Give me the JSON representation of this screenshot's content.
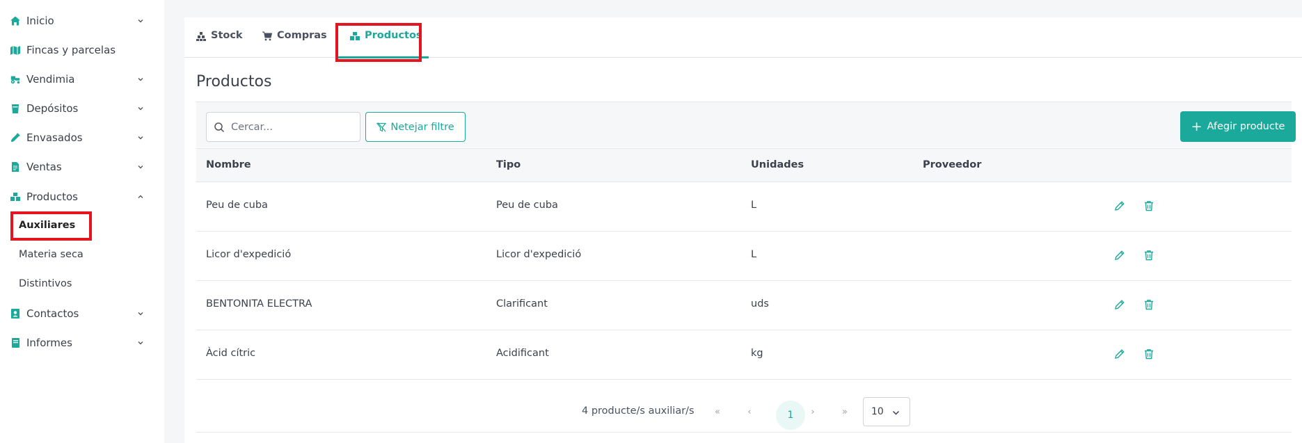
{
  "sidebar": {
    "items": [
      {
        "label": "Inicio",
        "icon": "home-icon"
      },
      {
        "label": "Fincas y parcelas",
        "icon": "map-icon"
      },
      {
        "label": "Vendimia",
        "icon": "tractor-icon"
      },
      {
        "label": "Depósitos",
        "icon": "tank-icon"
      },
      {
        "label": "Envasados",
        "icon": "bottle-icon"
      },
      {
        "label": "Ventas",
        "icon": "document-icon"
      },
      {
        "label": "Productos",
        "icon": "boxes-icon"
      },
      {
        "label": "Contactos",
        "icon": "contact-icon"
      },
      {
        "label": "Informes",
        "icon": "book-icon"
      }
    ],
    "subitems": [
      {
        "label": "Auxiliares"
      },
      {
        "label": "Materia seca"
      },
      {
        "label": "Distintivos"
      }
    ]
  },
  "tabs": [
    {
      "label": "Stock",
      "icon": "stock-icon"
    },
    {
      "label": "Compras",
      "icon": "cart-icon"
    },
    {
      "label": "Productos",
      "icon": "boxes-icon"
    }
  ],
  "page": {
    "title": "Productos"
  },
  "toolbar": {
    "search_placeholder": "Cercar...",
    "filter_label": "Netejar filtre",
    "add_label": "Afegir producte"
  },
  "table": {
    "headers": [
      "Nombre",
      "Tipo",
      "Unidades",
      "Proveedor"
    ],
    "rows": [
      {
        "nombre": "Peu de cuba",
        "tipo": "Peu de cuba",
        "unidades": "L",
        "proveedor": ""
      },
      {
        "nombre": "Licor d'expedició",
        "tipo": "Licor d'expedició",
        "unidades": "L",
        "proveedor": ""
      },
      {
        "nombre": "BENTONITA ELECTRA",
        "tipo": "Clarificant",
        "unidades": "uds",
        "proveedor": ""
      },
      {
        "nombre": "Àcid cítric",
        "tipo": "Acidificant",
        "unidades": "kg",
        "proveedor": ""
      }
    ]
  },
  "pagination": {
    "count_text": "4 producte/s auxiliar/s",
    "first": "«",
    "prev": "‹",
    "current_page": "1",
    "next": "›",
    "last": "»",
    "page_size": "10"
  },
  "colors": {
    "accent": "#1aa99a",
    "highlight": "#e5141e"
  }
}
